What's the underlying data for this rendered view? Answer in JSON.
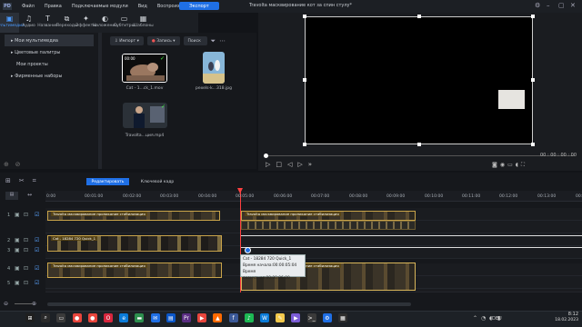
{
  "app": {
    "logo_text": "PD",
    "title": "Travolta масквирование кот за спин стулу*"
  },
  "menu": [
    "Файл",
    "Правка",
    "Подключаемые модули",
    "Вид",
    "Воспроизведение"
  ],
  "toolbar": {
    "export_label": "Экспорт"
  },
  "media_tabs": [
    {
      "label": "Мультимедиа",
      "icon": "media-icon",
      "glyph": "▣"
    },
    {
      "label": "Аудио",
      "icon": "music-note-icon",
      "glyph": "♫"
    },
    {
      "label": "Название",
      "icon": "title-t-icon",
      "glyph": "T"
    },
    {
      "label": "Переходы",
      "icon": "transition-icon",
      "glyph": "⧉"
    },
    {
      "label": "Эффекты",
      "icon": "effects-sparkle-icon",
      "glyph": "✦"
    },
    {
      "label": "Наложение",
      "icon": "overlay-icon",
      "glyph": "◐"
    },
    {
      "label": "Субтитры",
      "icon": "subtitles-icon",
      "glyph": "▭"
    },
    {
      "label": "Шаблоны",
      "icon": "templates-icon",
      "glyph": "▦"
    }
  ],
  "sidebar": {
    "items": [
      "Мои мультимедиа",
      "Цветовые палитры",
      "Мои проекты",
      "Фирменные наборы"
    ]
  },
  "library": {
    "import_label": "Импорт",
    "record_label": "Запись",
    "search_placeholder": "Поиск",
    "items": [
      {
        "name": "Cat - 1...ck_1.mov",
        "badge": "00:00"
      },
      {
        "name": "pexels-k...318.jpg",
        "badge": ""
      },
      {
        "name": "Travolta...ция.mp4",
        "badge": ""
      }
    ]
  },
  "preview": {
    "timecode": "00 : 00 : 00 : 00"
  },
  "timeline": {
    "tab_edit": "Редактировать",
    "tab_keyframe": "Ключевой кадр",
    "ticks": [
      "0:00",
      "00:01:00",
      "00:02:00",
      "00:03:00",
      "00:04:00",
      "00:05:00",
      "00:06:00",
      "00:07:00",
      "00:08:00",
      "00:09:00",
      "00:10:00",
      "00:11:00",
      "00:12:00",
      "00:13:00",
      "00:14:00"
    ],
    "clip_travolta": "Travolta масквирование проникание стабилизация",
    "clip_cat": "Cat - 18284 720 Quick_1",
    "tooltip": {
      "title": "Cat - 18284 720 Quick_1",
      "start": "Время начала:00:00:05:04",
      "end": "Время окончания:00:00:06:00"
    },
    "track_numbers": [
      "1",
      "2",
      "3",
      "4",
      "5"
    ]
  },
  "taskbar": {
    "lang": "DEU",
    "time": "8:12",
    "date": "18.02.2023"
  }
}
